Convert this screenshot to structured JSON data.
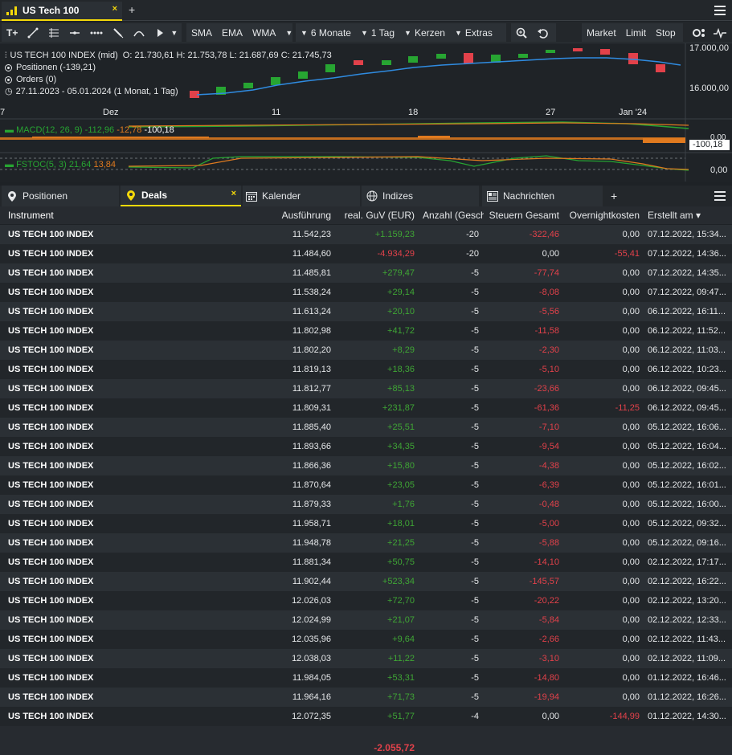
{
  "tabs": {
    "active_title": "US Tech 100",
    "close_symbol": "×",
    "add_symbol": "+"
  },
  "toolbar": {
    "text_tool": "T+",
    "sma": "SMA",
    "ema": "EMA",
    "wma": "WMA",
    "period": "6 Monate",
    "interval": "1 Tag",
    "chart_type": "Kerzen",
    "extras": "Extras",
    "market": "Market",
    "limit": "Limit",
    "stop": "Stop"
  },
  "chart": {
    "instrument_line": "US TECH 100 INDEX (mid)",
    "ohlc": "O: 21.730,61  H: 21.753,78  L: 21.687,69  C: 21.745,73",
    "positions": "Positionen (-139,21)",
    "orders": "Orders (0)",
    "range": "27.11.2023 - 05.01.2024  (1 Monat, 1 Tag)",
    "price_top": "17.000,00",
    "price_mid": "16.000,00",
    "x_labels": [
      "7",
      "Dez",
      "11",
      "18",
      "27",
      "Jan '24"
    ],
    "macd_label": "MACD(12, 26, 9)",
    "macd_v1": "-112,96",
    "macd_v2": "-12,78",
    "macd_v3": "-100,18",
    "macd_right": "-100,18",
    "macd_zero": "0,00",
    "fstoc_label": "FSTOC(5, 3)",
    "fstoc_v1": "21,64",
    "fstoc_v2": "13,84",
    "fstoc_right": "0,00",
    "colors": {
      "up": "#27a532",
      "down": "#e2414a",
      "ma": "#2f8be0",
      "macd_line": "#27a532",
      "signal": "#e07a1f"
    }
  },
  "bottom_tabs": {
    "positionen": "Positionen",
    "deals": "Deals",
    "kalender": "Kalender",
    "indizes": "Indizes",
    "nachrichten": "Nachrichten",
    "add": "+"
  },
  "table": {
    "headers": {
      "instrument": "Instrument",
      "ausfuehrung": "Ausführung",
      "guv": "real. GuV (EUR)",
      "anzahl": "Anzahl (Geschl",
      "steuern": "Steuern Gesamt",
      "overnight": "Overnightkosten",
      "erstellt": "Erstellt am ▾"
    },
    "rows": [
      {
        "inst": "US TECH 100 INDEX",
        "ausf": "11.542,23",
        "guv": "+1.159,23",
        "anz": "-20",
        "steu": "-322,46",
        "over": "0,00",
        "erst": "07.12.2022, 15:34..."
      },
      {
        "inst": "US TECH 100 INDEX",
        "ausf": "11.484,60",
        "guv": "-4.934,29",
        "anz": "-20",
        "steu": "0,00",
        "over": "-55,41",
        "erst": "07.12.2022, 14:36..."
      },
      {
        "inst": "US TECH 100 INDEX",
        "ausf": "11.485,81",
        "guv": "+279,47",
        "anz": "-5",
        "steu": "-77,74",
        "over": "0,00",
        "erst": "07.12.2022, 14:35..."
      },
      {
        "inst": "US TECH 100 INDEX",
        "ausf": "11.538,24",
        "guv": "+29,14",
        "anz": "-5",
        "steu": "-8,08",
        "over": "0,00",
        "erst": "07.12.2022, 09:47..."
      },
      {
        "inst": "US TECH 100 INDEX",
        "ausf": "11.613,24",
        "guv": "+20,10",
        "anz": "-5",
        "steu": "-5,56",
        "over": "0,00",
        "erst": "06.12.2022, 16:11..."
      },
      {
        "inst": "US TECH 100 INDEX",
        "ausf": "11.802,98",
        "guv": "+41,72",
        "anz": "-5",
        "steu": "-11,58",
        "over": "0,00",
        "erst": "06.12.2022, 11:52..."
      },
      {
        "inst": "US TECH 100 INDEX",
        "ausf": "11.802,20",
        "guv": "+8,29",
        "anz": "-5",
        "steu": "-2,30",
        "over": "0,00",
        "erst": "06.12.2022, 11:03..."
      },
      {
        "inst": "US TECH 100 INDEX",
        "ausf": "11.819,13",
        "guv": "+18,36",
        "anz": "-5",
        "steu": "-5,10",
        "over": "0,00",
        "erst": "06.12.2022, 10:23..."
      },
      {
        "inst": "US TECH 100 INDEX",
        "ausf": "11.812,77",
        "guv": "+85,13",
        "anz": "-5",
        "steu": "-23,66",
        "over": "0,00",
        "erst": "06.12.2022, 09:45..."
      },
      {
        "inst": "US TECH 100 INDEX",
        "ausf": "11.809,31",
        "guv": "+231,87",
        "anz": "-5",
        "steu": "-61,36",
        "over": "-11,25",
        "erst": "06.12.2022, 09:45..."
      },
      {
        "inst": "US TECH 100 INDEX",
        "ausf": "11.885,40",
        "guv": "+25,51",
        "anz": "-5",
        "steu": "-7,10",
        "over": "0,00",
        "erst": "05.12.2022, 16:06..."
      },
      {
        "inst": "US TECH 100 INDEX",
        "ausf": "11.893,66",
        "guv": "+34,35",
        "anz": "-5",
        "steu": "-9,54",
        "over": "0,00",
        "erst": "05.12.2022, 16:04..."
      },
      {
        "inst": "US TECH 100 INDEX",
        "ausf": "11.866,36",
        "guv": "+15,80",
        "anz": "-5",
        "steu": "-4,38",
        "over": "0,00",
        "erst": "05.12.2022, 16:02..."
      },
      {
        "inst": "US TECH 100 INDEX",
        "ausf": "11.870,64",
        "guv": "+23,05",
        "anz": "-5",
        "steu": "-6,39",
        "over": "0,00",
        "erst": "05.12.2022, 16:01..."
      },
      {
        "inst": "US TECH 100 INDEX",
        "ausf": "11.879,33",
        "guv": "+1,76",
        "anz": "-5",
        "steu": "-0,48",
        "over": "0,00",
        "erst": "05.12.2022, 16:00..."
      },
      {
        "inst": "US TECH 100 INDEX",
        "ausf": "11.958,71",
        "guv": "+18,01",
        "anz": "-5",
        "steu": "-5,00",
        "over": "0,00",
        "erst": "05.12.2022, 09:32..."
      },
      {
        "inst": "US TECH 100 INDEX",
        "ausf": "11.948,78",
        "guv": "+21,25",
        "anz": "-5",
        "steu": "-5,88",
        "over": "0,00",
        "erst": "05.12.2022, 09:16..."
      },
      {
        "inst": "US TECH 100 INDEX",
        "ausf": "11.881,34",
        "guv": "+50,75",
        "anz": "-5",
        "steu": "-14,10",
        "over": "0,00",
        "erst": "02.12.2022, 17:17..."
      },
      {
        "inst": "US TECH 100 INDEX",
        "ausf": "11.902,44",
        "guv": "+523,34",
        "anz": "-5",
        "steu": "-145,57",
        "over": "0,00",
        "erst": "02.12.2022, 16:22..."
      },
      {
        "inst": "US TECH 100 INDEX",
        "ausf": "12.026,03",
        "guv": "+72,70",
        "anz": "-5",
        "steu": "-20,22",
        "over": "0,00",
        "erst": "02.12.2022, 13:20..."
      },
      {
        "inst": "US TECH 100 INDEX",
        "ausf": "12.024,99",
        "guv": "+21,07",
        "anz": "-5",
        "steu": "-5,84",
        "over": "0,00",
        "erst": "02.12.2022, 12:33..."
      },
      {
        "inst": "US TECH 100 INDEX",
        "ausf": "12.035,96",
        "guv": "+9,64",
        "anz": "-5",
        "steu": "-2,66",
        "over": "0,00",
        "erst": "02.12.2022, 11:43..."
      },
      {
        "inst": "US TECH 100 INDEX",
        "ausf": "12.038,03",
        "guv": "+11,22",
        "anz": "-5",
        "steu": "-3,10",
        "over": "0,00",
        "erst": "02.12.2022, 11:09..."
      },
      {
        "inst": "US TECH 100 INDEX",
        "ausf": "11.984,05",
        "guv": "+53,31",
        "anz": "-5",
        "steu": "-14,80",
        "over": "0,00",
        "erst": "01.12.2022, 16:46..."
      },
      {
        "inst": "US TECH 100 INDEX",
        "ausf": "11.964,16",
        "guv": "+71,73",
        "anz": "-5",
        "steu": "-19,94",
        "over": "0,00",
        "erst": "01.12.2022, 16:26..."
      },
      {
        "inst": "US TECH 100 INDEX",
        "ausf": "12.072,35",
        "guv": "+51,77",
        "anz": "-4",
        "steu": "0,00",
        "over": "-144,99",
        "erst": "01.12.2022, 14:30..."
      }
    ],
    "total": "-2.055,72"
  }
}
